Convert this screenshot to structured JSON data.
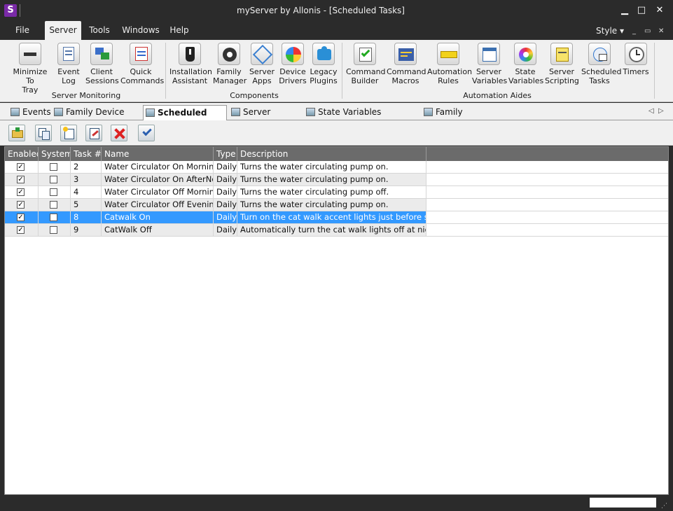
{
  "window": {
    "title": "myServer by Allonis - [Scheduled Tasks]",
    "logo_letter": "S",
    "minimize": "▁",
    "maximize": "□",
    "close": "✕"
  },
  "menu": {
    "items": [
      "File",
      "Server",
      "Tools",
      "Windows",
      "Help"
    ],
    "active": "Server",
    "style_label": "Style ▾",
    "mdi_min": "_",
    "mdi_restore": "▭",
    "mdi_close": "✕"
  },
  "ribbon": {
    "groups": [
      {
        "label": "Server Monitoring",
        "buttons": [
          "Minimize To\nTray",
          "Event\nLog",
          "Client\nSessions",
          "Quick\nCommands"
        ]
      },
      {
        "label": "Components",
        "buttons": [
          "Installation\nAssistant",
          "Family\nManager",
          "Server\nApps",
          "Device\nDrivers",
          "Legacy\nPlugins"
        ]
      },
      {
        "label": "Automation Aides",
        "buttons": [
          "Command\nBuilder",
          "Command\nMacros",
          "Automation\nRules",
          "Server\nVariables",
          "State\nVariables",
          "Server\nScripting",
          "Scheduled\nTasks",
          "Timers"
        ]
      }
    ]
  },
  "tabs": [
    {
      "label": "Events",
      "active": false
    },
    {
      "label": "Family Device Drivers",
      "active": false
    },
    {
      "label": "Scheduled Tasks",
      "active": true
    },
    {
      "label": "Server Variables",
      "active": false
    },
    {
      "label": "State Variables (CycleStates)",
      "active": false
    },
    {
      "label": "Family Manager",
      "active": false
    }
  ],
  "tab_nav": {
    "prev": "◁",
    "next": "▷"
  },
  "toolbar": {
    "icons": [
      "open-folder-icon",
      "copy-icon",
      "new-task-icon",
      "edit-icon",
      "delete-icon",
      "check-icon"
    ]
  },
  "grid": {
    "columns": [
      "Enabled",
      "System",
      "Task #",
      "Name",
      "Type",
      "Description"
    ],
    "rows": [
      {
        "enabled": true,
        "system": false,
        "task": "2",
        "name": "Water Circulator On Morning",
        "type": "Daily",
        "description": "Turns the water circulating pump on.",
        "selected": false
      },
      {
        "enabled": true,
        "system": false,
        "task": "3",
        "name": "Water Circulator On AfterNoon",
        "type": "Daily",
        "description": "Turns the water circulating pump on.",
        "selected": false
      },
      {
        "enabled": true,
        "system": false,
        "task": "4",
        "name": "Water Circulator Off Morning",
        "type": "Daily",
        "description": "Turns the water circulating pump off.",
        "selected": false
      },
      {
        "enabled": true,
        "system": false,
        "task": "5",
        "name": "Water Circulator Off Evening",
        "type": "Daily",
        "description": "Turns the water circulating pump on.",
        "selected": false
      },
      {
        "enabled": true,
        "system": false,
        "task": "8",
        "name": "Catwalk On",
        "type": "Daily",
        "description": "Turn on the cat walk accent lights just before sunset",
        "selected": true
      },
      {
        "enabled": true,
        "system": false,
        "task": "9",
        "name": "CatWalk Off",
        "type": "Daily",
        "description": "Automatically turn the cat walk lights off at night",
        "selected": false
      }
    ]
  },
  "status": {
    "grip": "⋰"
  }
}
